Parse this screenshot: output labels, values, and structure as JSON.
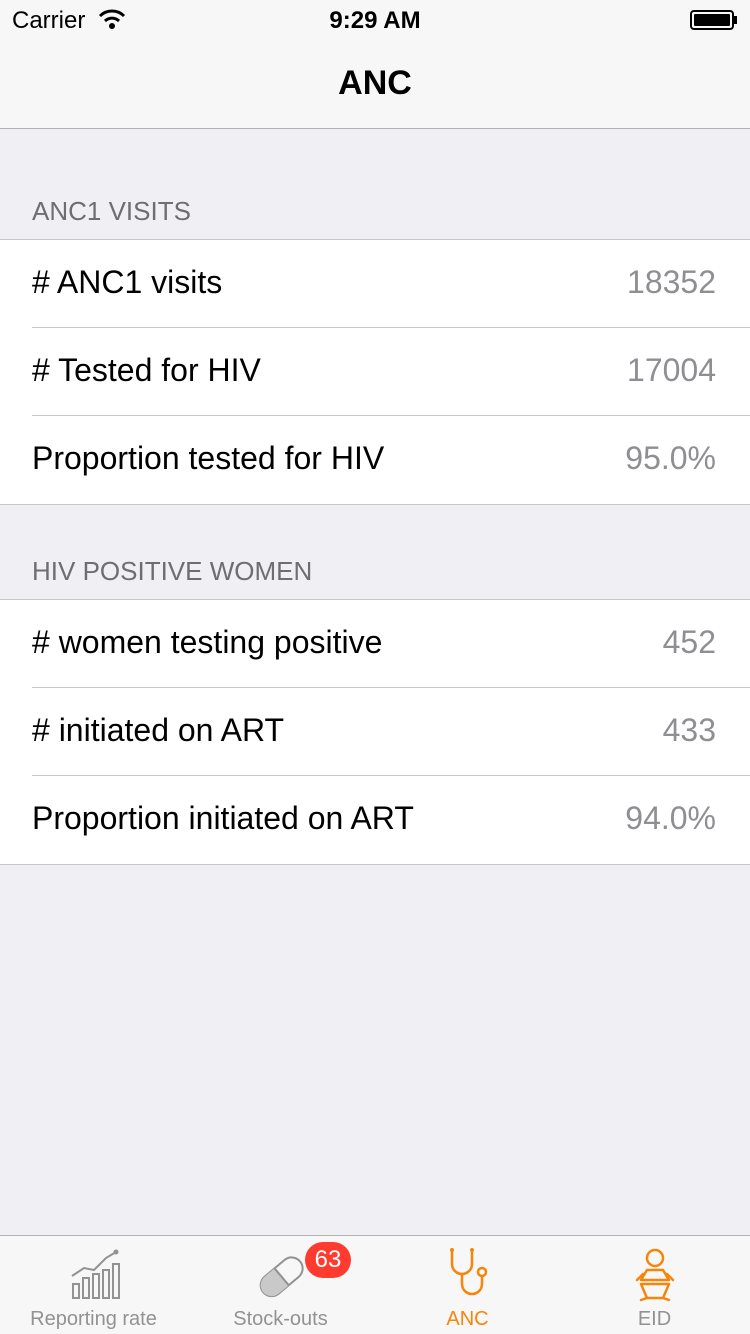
{
  "status_bar": {
    "carrier": "Carrier",
    "time": "9:29 AM"
  },
  "nav": {
    "title": "ANC"
  },
  "sections": [
    {
      "header": "ANC1 VISITS",
      "rows": [
        {
          "label": "# ANC1 visits",
          "value": "18352"
        },
        {
          "label": "# Tested for HIV",
          "value": "17004"
        },
        {
          "label": "Proportion tested for HIV",
          "value": "95.0%"
        }
      ]
    },
    {
      "header": "HIV POSITIVE WOMEN",
      "rows": [
        {
          "label": "# women testing positive",
          "value": "452"
        },
        {
          "label": "# initiated on ART",
          "value": "433"
        },
        {
          "label": "Proportion initiated on ART",
          "value": "94.0%"
        }
      ]
    }
  ],
  "tabs": [
    {
      "label": "Reporting rate",
      "icon": "chart-icon"
    },
    {
      "label": "Stock-outs",
      "icon": "pill-icon",
      "badge": "63"
    },
    {
      "label": "ANC",
      "icon": "stethoscope-icon",
      "active": true
    },
    {
      "label": "EID",
      "icon": "baby-icon"
    }
  ],
  "colors": {
    "accent": "#f7850a",
    "badge": "#ff3b30",
    "inactive": "#929292"
  }
}
